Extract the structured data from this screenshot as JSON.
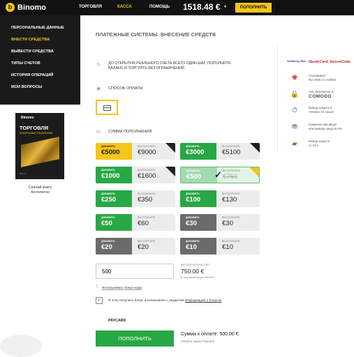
{
  "header": {
    "logo_text": "Binomo",
    "nav": [
      "ТОРГОВЛЯ",
      "КАССА",
      "ПОМОЩЬ"
    ],
    "balance": "1518.48 €",
    "balance_caret": "▾",
    "topup_label": "ПОПОЛНИТЬ"
  },
  "sidebar": {
    "items": [
      "ПЕРСОНАЛЬНЫЕ ДАННЫЕ",
      "ВНЕСТИ СРЕДСТВА",
      "ВЫВЕСТИ СРЕДСТВА",
      "ТИПЫ СЧЕТОВ",
      "ИСТОРИЯ ОПЕРАЦИЙ",
      "МОИ ВОПРОСЫ"
    ],
    "active_index": 1
  },
  "book": {
    "logo": "Binomo",
    "title": "ТОРГОВЛЯ",
    "subtitle": "БИНАРНЫМИ ОПЦИОНАМИ",
    "caption_line1": "Скачай книгу",
    "caption_line2": "бесплатно"
  },
  "main": {
    "title": "ПЛАТЕЖНЫЕ СИСТЕМЫ. ВНЕСЕНИЕ СРЕДСТВ",
    "info_text": "ДО ОТКРЫТИЯ РЕАЛЬНОГО СЧЕТА ВСЕГО ОДИН ШАГ. ПОПОЛНИТЕ БАЛАНС И ТОРГУЙТЕ БЕЗ ОГРАНИЧЕНИЙ",
    "payment_method_label": "СПОСОБ ОПЛАТЫ",
    "amount_label": "СУММА ПОПОЛНЕНИЯ",
    "tile_add_label": "ДОБАВИТЬ",
    "tile_receive_label": "ВЫ ПОЛУЧИТЕ",
    "tiles": [
      {
        "add": "€5000",
        "receive": "€9000",
        "style": "yellow",
        "badge": true
      },
      {
        "add": "€3000",
        "receive": "€5100",
        "style": "green",
        "badge": true
      },
      {
        "add": "€1000",
        "receive": "€1600",
        "style": "green",
        "badge": true
      },
      {
        "add": "€500",
        "receive": "€750",
        "style": "selected",
        "badge": true
      },
      {
        "add": "€250",
        "receive": "€350",
        "style": "green",
        "badge": false
      },
      {
        "add": "€100",
        "receive": "€130",
        "style": "green",
        "badge": false
      },
      {
        "add": "€50",
        "receive": "€60",
        "style": "green",
        "badge": false
      },
      {
        "add": "€30",
        "receive": "€30",
        "style": "gray",
        "badge": false
      },
      {
        "add": "€20",
        "receive": "€20",
        "style": "gray",
        "badge": false
      },
      {
        "add": "€10",
        "receive": "€10",
        "style": "gray",
        "badge": false
      }
    ],
    "amount_value": "500",
    "receive_on_account_label": "ВЫ ПОЛУЧИТЕ НА СЧЕТ",
    "receive_on_account_value": "750.00 €",
    "bonus_included": "В том числе бонус 250.00 €",
    "use_bonus_code": "Использовать бонус-коды",
    "agree_prefix": "Я хочу получить бонус и ознакомлен с разделом",
    "agree_link": "Информация о бонусах",
    "agree_checked": "✓",
    "payment_system": "PAYCARD",
    "submit_label": "ПОПОЛНИТЬ",
    "pay_total": "Сумма к оплате: 500.00 €",
    "pay_via": "Оплата через Paycard"
  },
  "trust": {
    "verified_visa": "Verified by VISA",
    "mastercard": "MasterCard. SecureCode.",
    "certificate_line1": "Сертификат",
    "certificate_line2": "RU 0395 AA Vv0092",
    "ssl_label": "SSL-безопасность",
    "comodo": "COMODO",
    "withdraw_line1": "Вывод средств в",
    "withdraw_line2": "течение 24 часов!",
    "commission_line1": "Комиссия при вводе",
    "commission_line2": "или выводе средств 0%",
    "min_withdraw_line1": "Вывод средств",
    "min_withdraw_line2": "от 10 €."
  },
  "colors": {
    "accent": "#f6c519",
    "green": "#27a844",
    "dark": "#121212"
  }
}
